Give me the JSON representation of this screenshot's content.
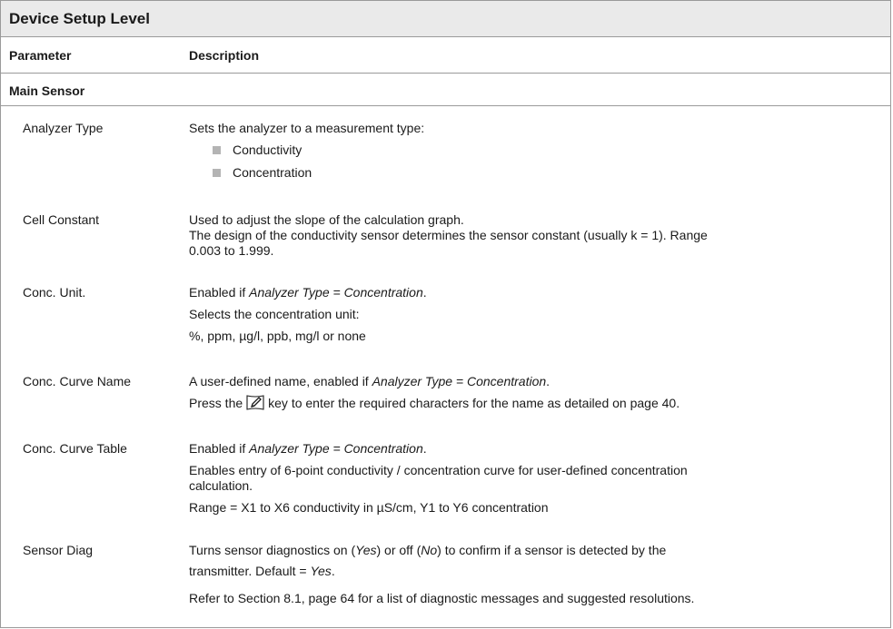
{
  "table": {
    "title": "Device Setup Level",
    "col_param": "Parameter",
    "col_desc": "Description",
    "section": "Main Sensor"
  },
  "rows": {
    "analyzer_type": {
      "name": "Analyzer Type",
      "desc": "Sets the analyzer to a measurement type:",
      "options": [
        "Conductivity",
        "Concentration"
      ]
    },
    "cell_constant": {
      "name": "Cell Constant",
      "line1": "Used to adjust the slope of the calculation graph.",
      "line2": "The design of the conductivity sensor determines the sensor constant (usually k = 1). Range",
      "line3": "0.003 to 1.999."
    },
    "conc_unit": {
      "name": "Conc. Unit.",
      "line1_pre": "Enabled if ",
      "line1_em": "Analyzer Type = Concentration",
      "line1_post": ".",
      "line2": "Selects the concentration unit:",
      "line3": "%, ppm, µg/l, ppb, mg/l or none"
    },
    "conc_curve_name": {
      "name": "Conc. Curve Name",
      "line1_pre": "A user-defined name, enabled if ",
      "line1_em": "Analyzer Type = Concentration",
      "line1_post": ".",
      "line2_pre": "Press the",
      "line2_post": "key to enter the required characters for the name as detailed on page 40.",
      "key_icon": "edit-key-icon"
    },
    "conc_curve_table": {
      "name": "Conc. Curve Table",
      "line1_pre": "Enabled if ",
      "line1_em": "Analyzer Type = Concentration",
      "line1_post": ".",
      "line2": "Enables entry of 6-point conductivity / concentration curve for user-defined concentration",
      "line3": "calculation.",
      "line4": "Range = X1 to X6 conductivity in µS/cm, Y1 to Y6 concentration"
    },
    "sensor_diag": {
      "name": "Sensor Diag",
      "line1_a": "Turns sensor diagnostics on (",
      "line1_yes": "Yes",
      "line1_b": ") or off (",
      "line1_no": "No",
      "line1_c": ") to confirm if a sensor is detected by the",
      "line2_pre": "transmitter. Default = ",
      "line2_em": "Yes",
      "line2_post": ".",
      "line3": "Refer to Section 8.1, page 64 for a list of diagnostic messages and suggested resolutions."
    }
  },
  "colors": {
    "header_bg": "#eaeaea",
    "rule": "#9a9a9a",
    "bullet": "#b4b4b4"
  }
}
